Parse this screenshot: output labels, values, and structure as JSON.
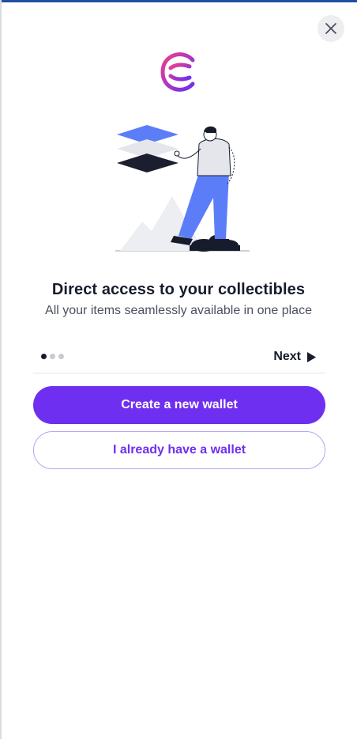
{
  "icons": {
    "close": "close-icon",
    "logo": "brand-logo",
    "next": "play-arrow-icon"
  },
  "colors": {
    "primary": "#6f2ff0",
    "secondary_border": "#b9a2f2",
    "heading": "#171c2c",
    "body_text": "#4b5060",
    "illustration_blue": "#5b7ef8"
  },
  "onboarding": {
    "title": "Direct access to your collectibles",
    "subtitle": "All your items seamlessly available in one place",
    "pager": {
      "total": 3,
      "current": 1
    },
    "next_label": "Next"
  },
  "actions": {
    "create_wallet_label": "Create a new wallet",
    "existing_wallet_label": "I already have a wallet"
  }
}
